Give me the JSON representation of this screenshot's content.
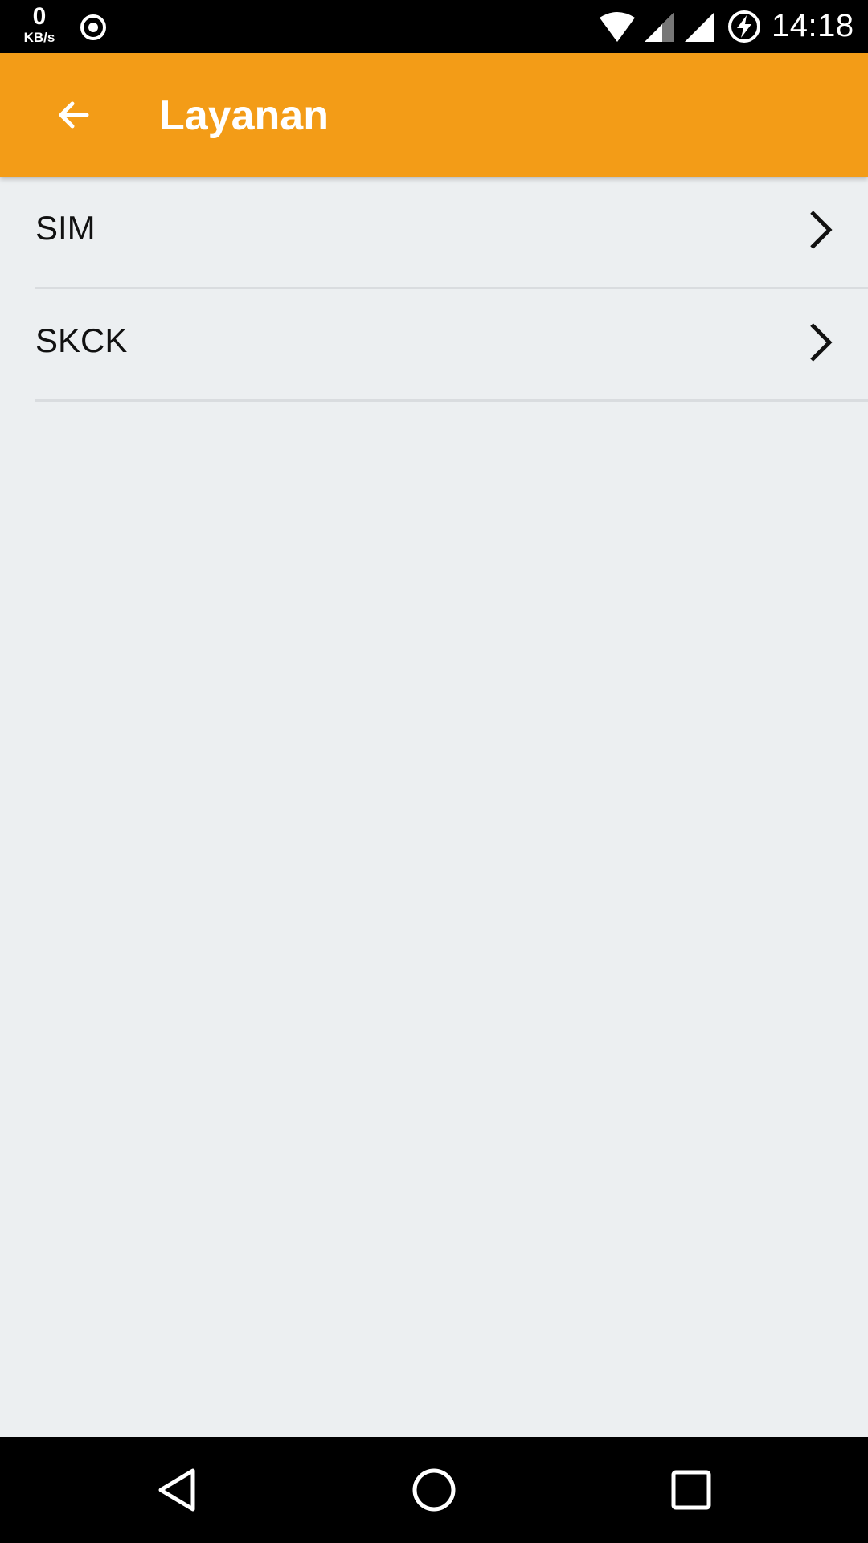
{
  "status_bar": {
    "net_speed_value": "0",
    "net_speed_unit": "KB/s",
    "time": "14:18",
    "icons": [
      "record-icon",
      "wifi-icon",
      "signal-icon",
      "battery-charging-icon"
    ]
  },
  "app_bar": {
    "title": "Layanan",
    "back_icon": "arrow-left-icon",
    "color": "#f39c17"
  },
  "list": {
    "items": [
      {
        "label": "SIM",
        "icon": "chevron-right-icon"
      },
      {
        "label": "SKCK",
        "icon": "chevron-right-icon"
      }
    ]
  },
  "nav_bar": {
    "icons": [
      "nav-back-icon",
      "nav-home-icon",
      "nav-recents-icon"
    ]
  }
}
